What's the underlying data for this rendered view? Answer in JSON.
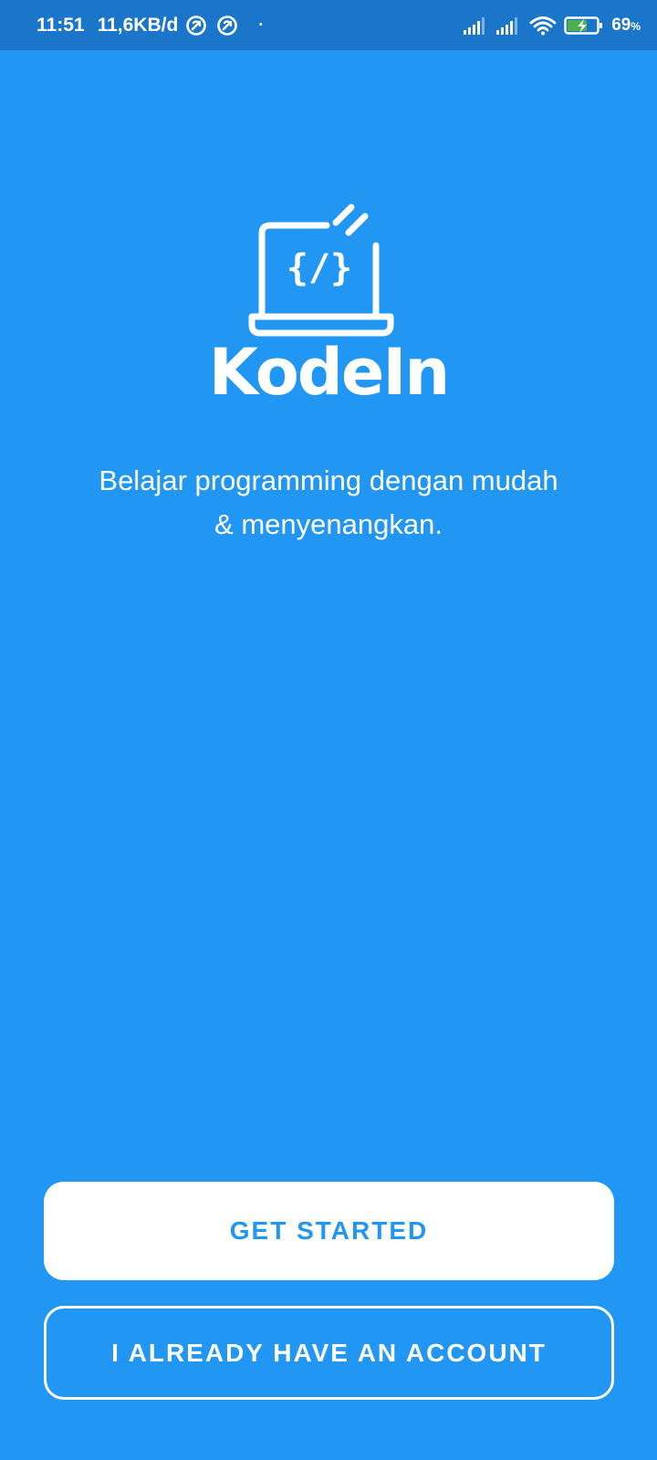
{
  "status_bar": {
    "time": "11:51",
    "speed": "11,6KB/d",
    "dot": "·",
    "battery_percent": "69",
    "battery_unit": "%",
    "icons": [
      "notification-app-icon",
      "notification-app-icon",
      "signal-icon",
      "signal-icon",
      "wifi-icon",
      "battery-charging-icon"
    ]
  },
  "app": {
    "logo_code": "{/}",
    "name": "KodeIn",
    "tagline_line1": "Belajar programming dengan mudah",
    "tagline_line2": "& menyenangkan."
  },
  "actions": {
    "get_started": "GET STARTED",
    "have_account": "I ALREADY HAVE AN ACCOUNT"
  },
  "colors": {
    "background": "#2196f3",
    "status_bar": "#1b76c9",
    "primary_text": "#ffffff",
    "accent": "#2196f3",
    "battery_green": "#4caf50"
  }
}
